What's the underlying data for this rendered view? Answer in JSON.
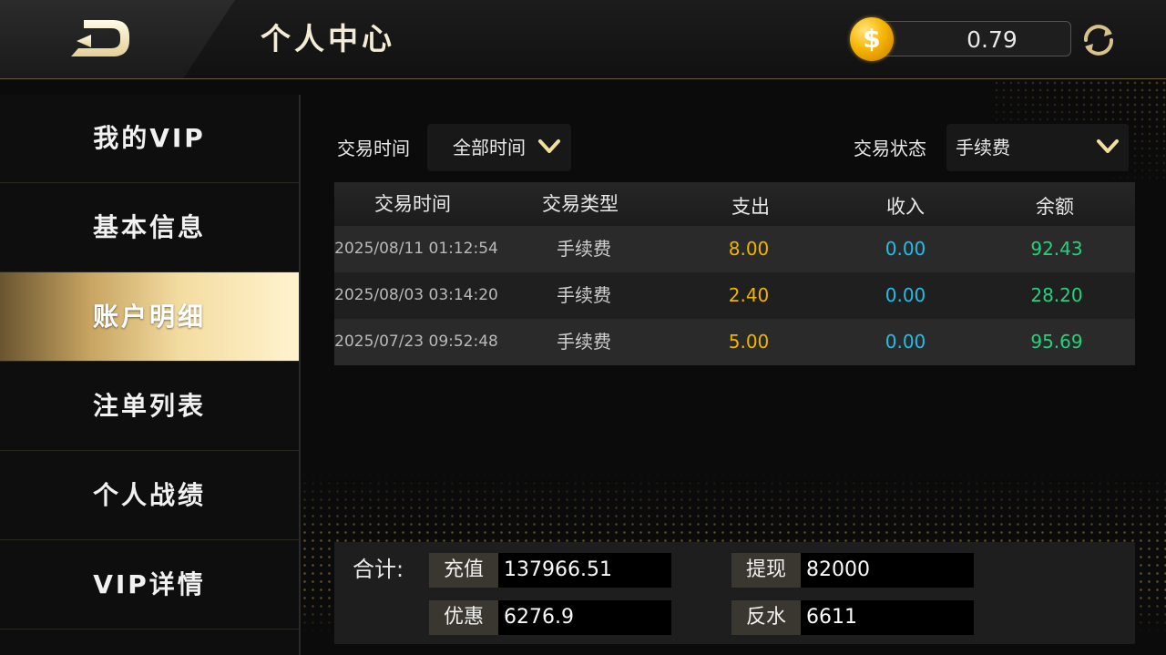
{
  "header": {
    "title": "个人中心",
    "balance": "0.79",
    "coin_icon": "coin-icon",
    "coin_symbol": "$",
    "refresh_icon": "refresh-icon",
    "back_icon": "back-icon"
  },
  "sidebar": {
    "items": [
      {
        "label": "我的VIP",
        "active": false
      },
      {
        "label": "基本信息",
        "active": false
      },
      {
        "label": "账户明细",
        "active": true
      },
      {
        "label": "注单列表",
        "active": false
      },
      {
        "label": "个人战绩",
        "active": false
      },
      {
        "label": "VIP详情",
        "active": false
      }
    ]
  },
  "filters": {
    "time_label": "交易时间",
    "time_value": "全部时间",
    "status_label": "交易状态",
    "status_value": "手续费"
  },
  "table": {
    "columns": [
      "交易时间",
      "交易类型",
      "支出",
      "收入",
      "余额"
    ],
    "rows": [
      {
        "time": "2025/08/11 01:12:54",
        "type": "手续费",
        "out": "8.00",
        "in": "0.00",
        "balance": "92.43"
      },
      {
        "time": "2025/08/03 03:14:20",
        "type": "手续费",
        "out": "2.40",
        "in": "0.00",
        "balance": "28.20"
      },
      {
        "time": "2025/07/23 09:52:48",
        "type": "手续费",
        "out": "5.00",
        "in": "0.00",
        "balance": "95.69"
      }
    ]
  },
  "summary": {
    "title": "合计:",
    "recharge_label": "充值",
    "recharge_value": "137966.51",
    "withdraw_label": "提现",
    "withdraw_value": "82000",
    "bonus_label": "优惠",
    "bonus_value": "6276.9",
    "rebate_label": "反水",
    "rebate_value": "6611"
  },
  "colors": {
    "accent_gold": "#c7a461",
    "expense": "#f0b400",
    "income": "#1fbfe8",
    "balance": "#22d37a"
  }
}
